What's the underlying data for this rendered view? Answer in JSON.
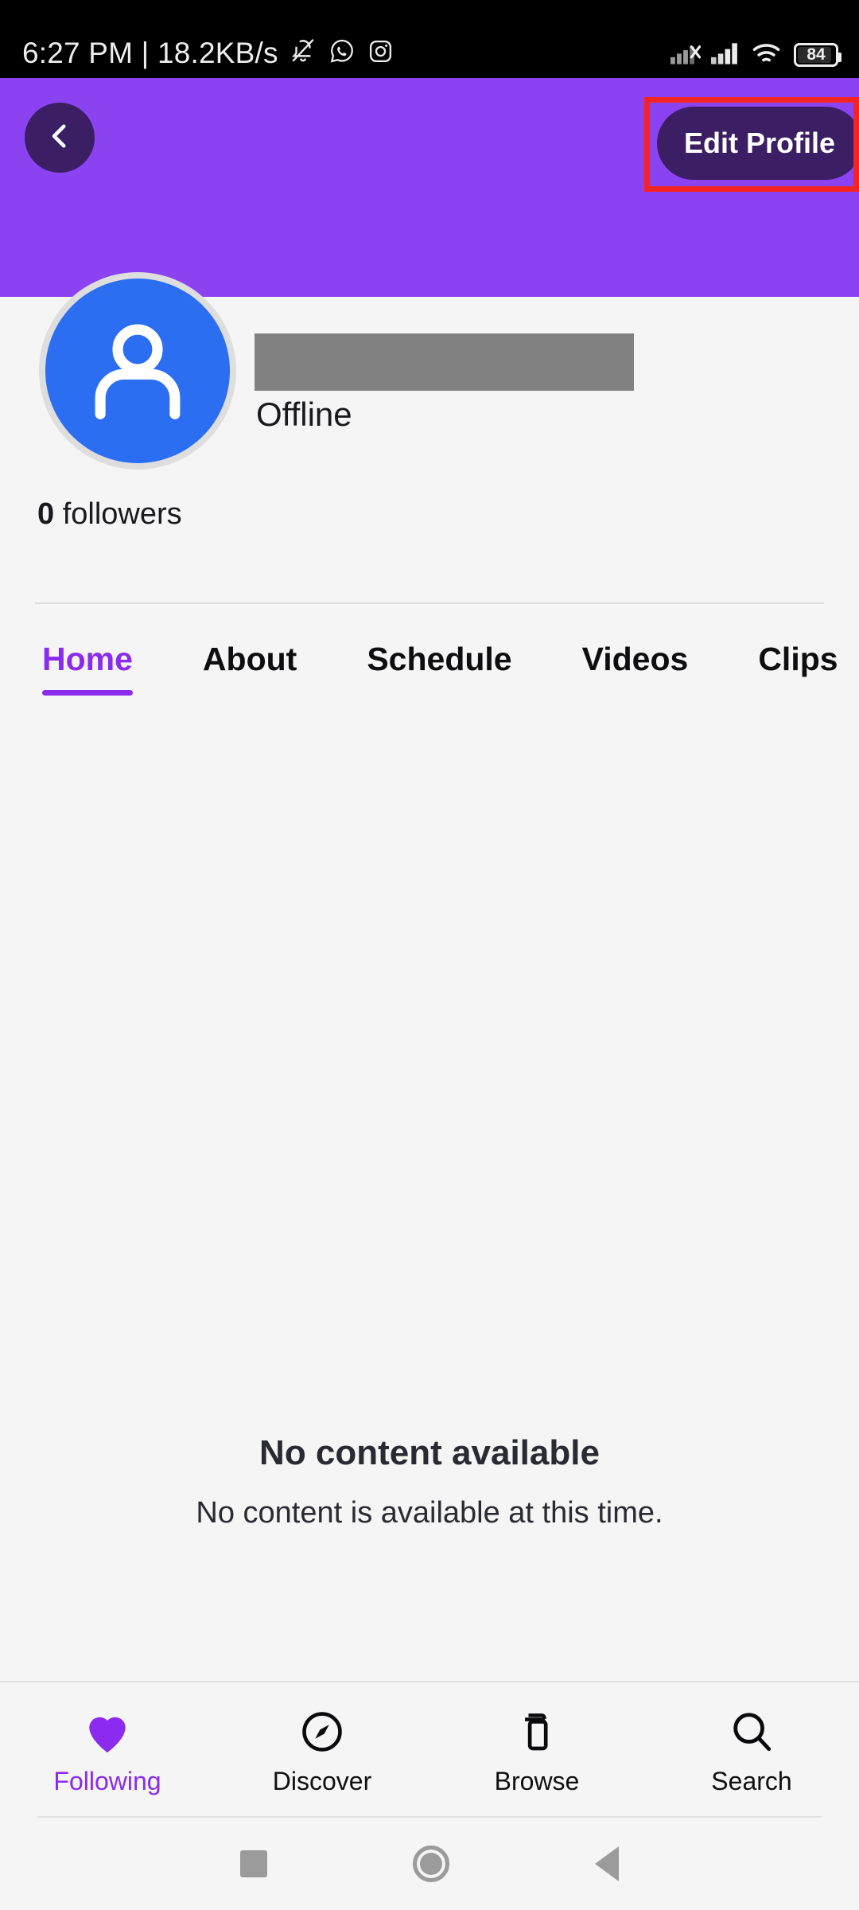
{
  "status_bar": {
    "clock": "6:27 PM | 18.2KB/s",
    "icons": [
      "bell-muted-icon",
      "whatsapp-icon",
      "instagram-icon"
    ],
    "right_icons": [
      "signal-no-service-icon",
      "signal-bars-icon",
      "wifi-icon"
    ],
    "battery_level": "84"
  },
  "header": {
    "background_color": "#8B43F2",
    "back_icon": "chevron-left-icon",
    "edit_profile_label": "Edit Profile",
    "highlight_color": "#F42424"
  },
  "profile": {
    "avatar_icon": "person-avatar-icon",
    "avatar_color": "#2C6EF2",
    "display_name": "",
    "status": "Offline",
    "followers_count": "0",
    "followers_label": "followers"
  },
  "tabs": {
    "active_color": "#8B2BF0",
    "items": [
      {
        "label": "Home"
      },
      {
        "label": "About"
      },
      {
        "label": "Schedule"
      },
      {
        "label": "Videos"
      },
      {
        "label": "Clips"
      }
    ]
  },
  "empty_state": {
    "title": "No content available",
    "subtitle": "No content is available at this time."
  },
  "bottom_nav": {
    "active_color": "#8B2BF0",
    "items": [
      {
        "label": "Following",
        "icon": "heart-icon"
      },
      {
        "label": "Discover",
        "icon": "compass-icon"
      },
      {
        "label": "Browse",
        "icon": "copy-icon"
      },
      {
        "label": "Search",
        "icon": "magnifier-icon"
      }
    ]
  },
  "system_nav": {
    "recents_icon": "square-icon",
    "home_icon": "circle-icon",
    "back_icon": "triangle-left-icon"
  }
}
